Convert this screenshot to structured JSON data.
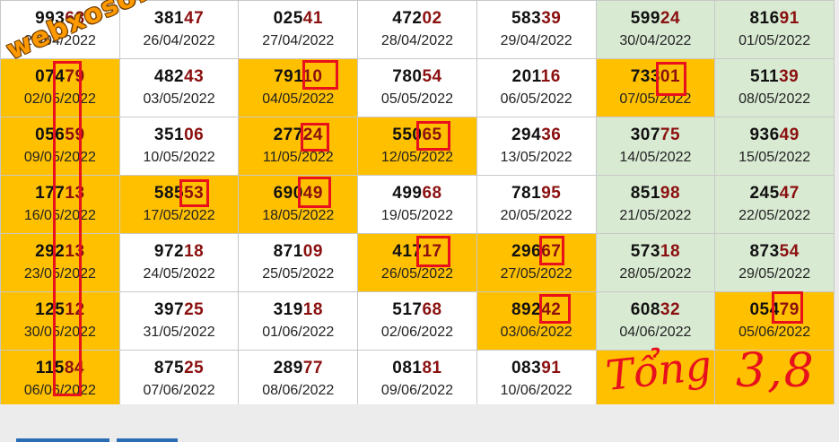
{
  "watermark": "webxoso.net",
  "annotation": {
    "left": "Tổng",
    "right": "3,8"
  },
  "rows": [
    [
      {
        "head": "993",
        "tail": "68",
        "date": "25/04/2022",
        "color": "white"
      },
      {
        "head": "381",
        "tail": "47",
        "date": "26/04/2022",
        "color": "white"
      },
      {
        "head": "025",
        "tail": "41",
        "date": "27/04/2022",
        "color": "white"
      },
      {
        "head": "472",
        "tail": "02",
        "date": "28/04/2022",
        "color": "white"
      },
      {
        "head": "583",
        "tail": "39",
        "date": "29/04/2022",
        "color": "white"
      },
      {
        "head": "599",
        "tail": "24",
        "date": "30/04/2022",
        "color": "green"
      },
      {
        "head": "816",
        "tail": "91",
        "date": "01/05/2022",
        "color": "green"
      }
    ],
    [
      {
        "head": "074",
        "tail": "79",
        "date": "02/05/2022",
        "color": "orange"
      },
      {
        "head": "482",
        "tail": "43",
        "date": "03/05/2022",
        "color": "white"
      },
      {
        "head": "791",
        "tail": "10",
        "date": "04/05/2022",
        "color": "orange"
      },
      {
        "head": "780",
        "tail": "54",
        "date": "05/05/2022",
        "color": "white"
      },
      {
        "head": "201",
        "tail": "16",
        "date": "06/05/2022",
        "color": "white"
      },
      {
        "head": "733",
        "tail": "01",
        "date": "07/05/2022",
        "color": "orange"
      },
      {
        "head": "511",
        "tail": "39",
        "date": "08/05/2022",
        "color": "green"
      }
    ],
    [
      {
        "head": "056",
        "tail": "59",
        "date": "09/05/2022",
        "color": "orange"
      },
      {
        "head": "351",
        "tail": "06",
        "date": "10/05/2022",
        "color": "white"
      },
      {
        "head": "277",
        "tail": "24",
        "date": "11/05/2022",
        "color": "orange"
      },
      {
        "head": "550",
        "tail": "65",
        "date": "12/05/2022",
        "color": "orange"
      },
      {
        "head": "294",
        "tail": "36",
        "date": "13/05/2022",
        "color": "white"
      },
      {
        "head": "307",
        "tail": "75",
        "date": "14/05/2022",
        "color": "green"
      },
      {
        "head": "936",
        "tail": "49",
        "date": "15/05/2022",
        "color": "green"
      }
    ],
    [
      {
        "head": "177",
        "tail": "13",
        "date": "16/05/2022",
        "color": "orange"
      },
      {
        "head": "585",
        "tail": "53",
        "date": "17/05/2022",
        "color": "orange"
      },
      {
        "head": "690",
        "tail": "49",
        "date": "18/05/2022",
        "color": "orange"
      },
      {
        "head": "499",
        "tail": "68",
        "date": "19/05/2022",
        "color": "white"
      },
      {
        "head": "781",
        "tail": "95",
        "date": "20/05/2022",
        "color": "white"
      },
      {
        "head": "851",
        "tail": "98",
        "date": "21/05/2022",
        "color": "green"
      },
      {
        "head": "245",
        "tail": "47",
        "date": "22/05/2022",
        "color": "green"
      }
    ],
    [
      {
        "head": "292",
        "tail": "13",
        "date": "23/05/2022",
        "color": "orange"
      },
      {
        "head": "972",
        "tail": "18",
        "date": "24/05/2022",
        "color": "white"
      },
      {
        "head": "871",
        "tail": "09",
        "date": "25/05/2022",
        "color": "white"
      },
      {
        "head": "417",
        "tail": "17",
        "date": "26/05/2022",
        "color": "orange"
      },
      {
        "head": "296",
        "tail": "67",
        "date": "27/05/2022",
        "color": "orange"
      },
      {
        "head": "573",
        "tail": "18",
        "date": "28/05/2022",
        "color": "green"
      },
      {
        "head": "873",
        "tail": "54",
        "date": "29/05/2022",
        "color": "green"
      }
    ],
    [
      {
        "head": "125",
        "tail": "12",
        "date": "30/05/2022",
        "color": "orange"
      },
      {
        "head": "397",
        "tail": "25",
        "date": "31/05/2022",
        "color": "white"
      },
      {
        "head": "319",
        "tail": "18",
        "date": "01/06/2022",
        "color": "white"
      },
      {
        "head": "517",
        "tail": "68",
        "date": "02/06/2022",
        "color": "white"
      },
      {
        "head": "892",
        "tail": "42",
        "date": "03/06/2022",
        "color": "orange"
      },
      {
        "head": "608",
        "tail": "32",
        "date": "04/06/2022",
        "color": "green"
      },
      {
        "head": "054",
        "tail": "79",
        "date": "05/06/2022",
        "color": "orange"
      }
    ],
    [
      {
        "head": "115",
        "tail": "84",
        "date": "06/06/2022",
        "color": "orange"
      },
      {
        "head": "875",
        "tail": "25",
        "date": "07/06/2022",
        "color": "white"
      },
      {
        "head": "289",
        "tail": "77",
        "date": "08/06/2022",
        "color": "white"
      },
      {
        "head": "081",
        "tail": "81",
        "date": "09/06/2022",
        "color": "white"
      },
      {
        "head": "083",
        "tail": "91",
        "date": "10/06/2022",
        "color": "white"
      },
      {
        "head": "",
        "tail": "",
        "date": "",
        "color": "orange"
      },
      {
        "head": "",
        "tail": "",
        "date": "",
        "color": "orange"
      }
    ]
  ],
  "colors": {
    "orange": "#ffc000",
    "green": "#d9ead3",
    "mark": "#e8101c",
    "tail": "#8b1010"
  }
}
